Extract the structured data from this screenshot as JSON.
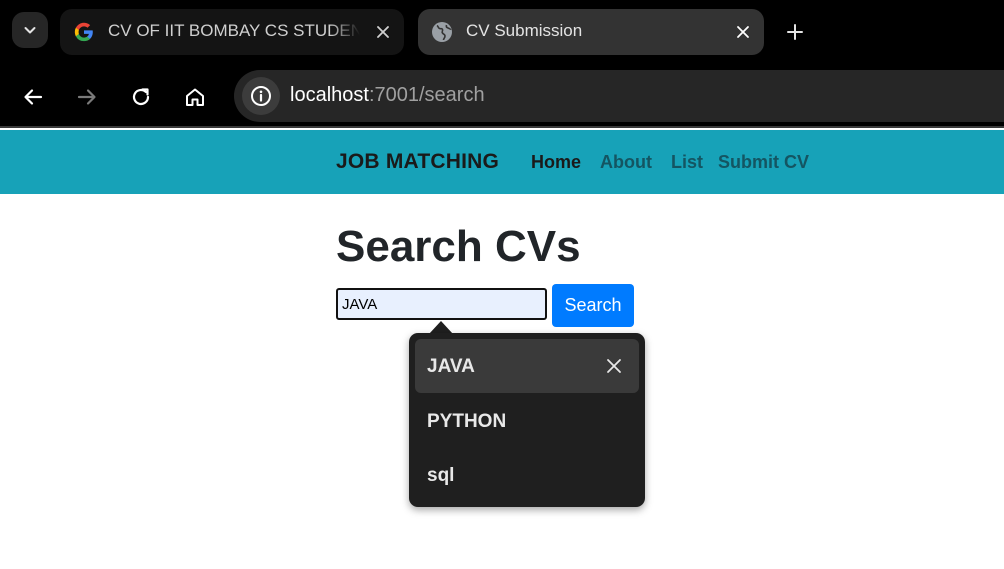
{
  "browser": {
    "tabs": [
      {
        "title": "CV OF IIT BOMBAY CS STUDENT",
        "favicon": "google-icon",
        "active": false
      },
      {
        "title": "CV Submission",
        "favicon": "globe-icon",
        "active": true
      }
    ],
    "address_bar": {
      "host": "localhost",
      "path": ":7001/search"
    }
  },
  "navbar": {
    "brand": "JOB MATCHING",
    "links": [
      {
        "label": "Home",
        "active": true
      },
      {
        "label": "About",
        "active": false
      },
      {
        "label": "List",
        "active": false
      },
      {
        "label": "Submit CV",
        "active": false
      }
    ],
    "background": "#17a2b8"
  },
  "main": {
    "title": "Search CVs",
    "search": {
      "value": "JAVA",
      "button_label": "Search",
      "button_color": "#007bff"
    }
  },
  "autocomplete": {
    "suggestions": [
      {
        "label": "JAVA",
        "selected": true,
        "removable": true
      },
      {
        "label": "PYTHON",
        "selected": false,
        "removable": false
      },
      {
        "label": "sql",
        "selected": false,
        "removable": false
      }
    ]
  }
}
